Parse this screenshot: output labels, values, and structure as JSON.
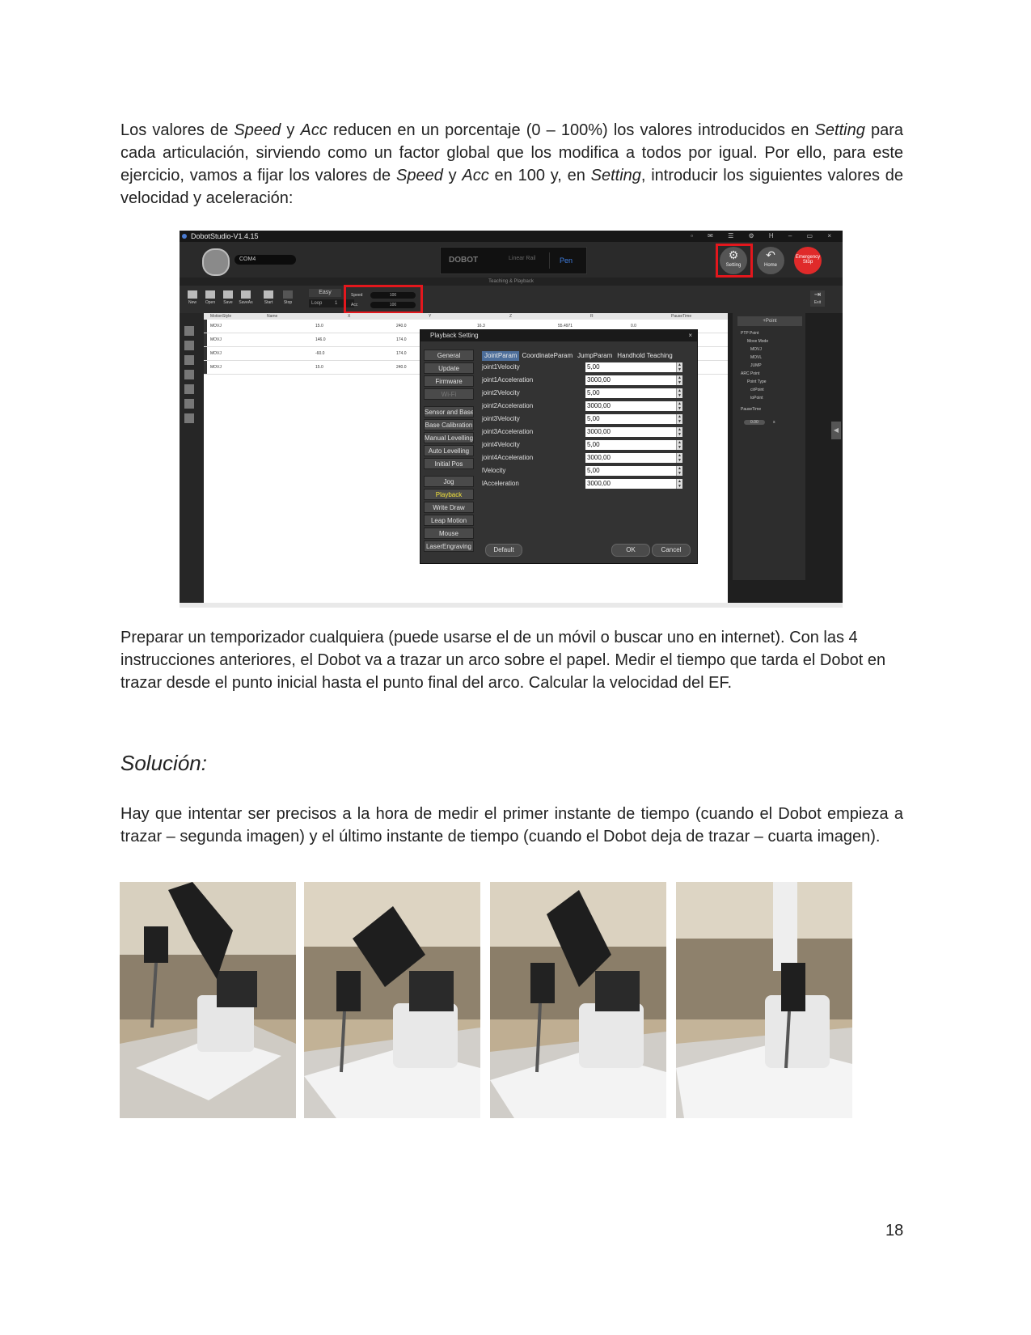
{
  "paragraph1": {
    "t1": "Los valores de ",
    "speed": "Speed",
    "t2": " y ",
    "acc": "Acc",
    "t3": " reducen en un porcentaje (0 – 100%) los valores introducidos en ",
    "setting": "Setting",
    "t4": " para cada articulación, sirviendo como un factor global que los modifica a todos por igual. Por ello, para este ejercicio, vamos a fijar los valores de ",
    "speed2": "Speed",
    "t5": " y ",
    "acc2": "Acc",
    "t6": " en 100 y, en ",
    "setting2": "Setting",
    "t7": ", introducir los siguientes valores de velocidad y aceleración:"
  },
  "screenshot": {
    "window_title": "DobotStudio-V1.4.15",
    "com_port": "COM4",
    "brand": "DOBOT",
    "device_labels": [
      "Linear Rail",
      "Pen"
    ],
    "buttons": {
      "setting": "Setting",
      "home": "Home",
      "estop": "Emergency Stop"
    },
    "section_label": "Teaching & Playback",
    "tools": [
      "New",
      "Open",
      "Save",
      "SaveAs",
      "Start",
      "Stop"
    ],
    "mode": "Easy",
    "loop_label": "Loop",
    "loop_value": "1",
    "speed_label": "Speed",
    "speed_value": "100",
    "acc_label": "Acc",
    "acc_value": "100",
    "exit": "Exit",
    "table_headers": [
      "MotionStyle",
      "Name",
      "X",
      "Y",
      "Z",
      "R",
      "PauseTime"
    ],
    "table_rows": [
      [
        "MOVJ",
        "",
        "15.0",
        "240.0",
        "16.3",
        "55.4971",
        "0.0"
      ],
      [
        "MOVJ",
        "",
        "146.0",
        "174.0",
        "",
        "",
        ""
      ],
      [
        "MOVJ",
        "",
        "-60.0",
        "174.0",
        "",
        "",
        ""
      ],
      [
        "MOVJ",
        "",
        "15.0",
        "240.0",
        "",
        "",
        ""
      ]
    ],
    "right_panel": {
      "add_point": "+Point",
      "ptp_mode": "PTP Point",
      "move_mode": "Move Mode",
      "movj": "MOVJ",
      "movl": "MOVL",
      "jump": "JUMP",
      "arc_mode": "ARC Point",
      "point_type": "Point Type",
      "cir_point": "cirPoint",
      "to_point": "toPoint",
      "pause_time": "PauseTime",
      "pause_value": "0.00",
      "unit": "s"
    },
    "dialog": {
      "title": "Playback Setting",
      "nav": [
        "General",
        "Update",
        "Firmware",
        "Wi-Fi",
        "Sensor and Base",
        "Base Calibration",
        "Manual Levelling",
        "Auto Levelling",
        "Initial Pos",
        "Jog",
        "Playback",
        "Write  Draw",
        "Leap Motion",
        "Mouse",
        "LaserEngraving"
      ],
      "tabs": [
        "JointParam",
        "CoordinateParam",
        "JumpParam",
        "Handhold Teaching"
      ],
      "params": [
        {
          "label": "joint1Velocity",
          "value": "5,00"
        },
        {
          "label": "joint1Acceleration",
          "value": "3000,00"
        },
        {
          "label": "joint2Velocity",
          "value": "5,00"
        },
        {
          "label": "joint2Acceleration",
          "value": "3000,00"
        },
        {
          "label": "joint3Velocity",
          "value": "5,00"
        },
        {
          "label": "joint3Acceleration",
          "value": "3000,00"
        },
        {
          "label": "joint4Velocity",
          "value": "5,00"
        },
        {
          "label": "joint4Acceleration",
          "value": "3000,00"
        },
        {
          "label": "lVelocity",
          "value": "5,00"
        },
        {
          "label": "lAcceleration",
          "value": "3000,00"
        }
      ],
      "default_btn": "Default",
      "ok_btn": "OK",
      "cancel_btn": "Cancel"
    }
  },
  "paragraph2": "Preparar un temporizador cualquiera (puede usarse el de un móvil o buscar uno en internet). Con las 4 instrucciones anteriores, el Dobot va a trazar un arco sobre el papel. Medir el tiempo que tarda el Dobot en trazar desde el punto inicial hasta el punto final del arco. Calcular la velocidad del EF.",
  "heading": "Solución:",
  "paragraph3": "Hay que intentar ser precisos a la hora de medir el primer instante de tiempo (cuando el Dobot empieza a trazar – segunda imagen) y el último instante de tiempo (cuando el Dobot deja de trazar – cuarta imagen).",
  "page_number": "18",
  "colors": {
    "highlight_box": "#e3171d",
    "active_nav": "#f2e23a",
    "selected_tab": "#4d6e9a",
    "estop": "#e02a2a"
  }
}
